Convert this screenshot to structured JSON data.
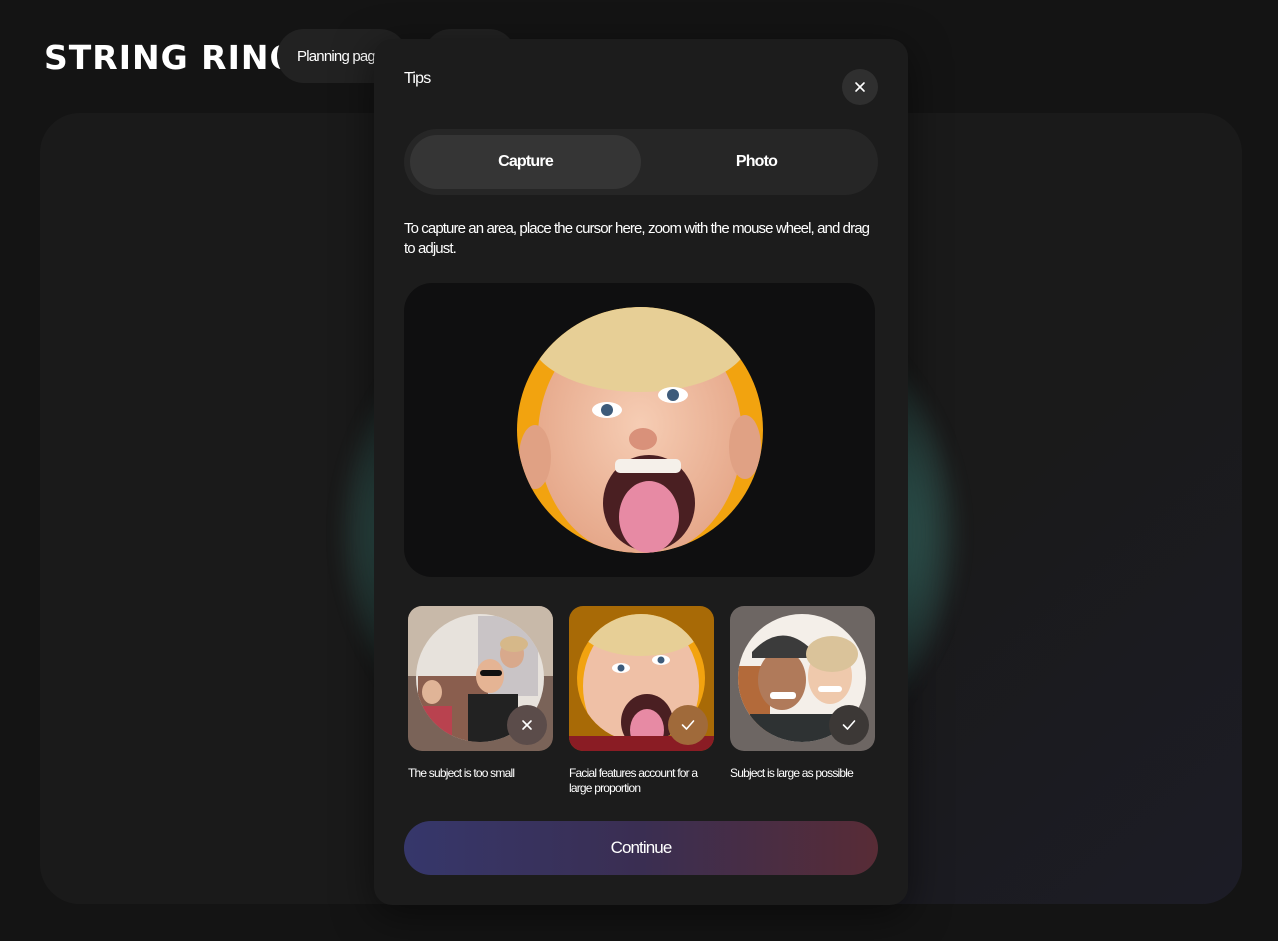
{
  "brand": {
    "logo_text": "STRING RING"
  },
  "nav": {
    "planning_label": "Planning page",
    "second_label": ""
  },
  "modal": {
    "title": "Tips",
    "tabs": [
      {
        "label": "Capture",
        "active": true
      },
      {
        "label": "Photo",
        "active": false
      }
    ],
    "description": "To capture an area, place the cursor here, zoom with the mouse wheel, and drag to adjust.",
    "examples": [
      {
        "caption": "The subject is too small",
        "status": "bad",
        "icon": "close-icon"
      },
      {
        "caption": "Facial features account for a large proportion",
        "status": "good",
        "icon": "check-icon"
      },
      {
        "caption": "Subject is large as possible",
        "status": "good",
        "icon": "check-icon"
      }
    ],
    "continue_label": "Continue"
  },
  "colors": {
    "background": "#141414",
    "modal": "#1c1c1c",
    "accent_orange": "#f2a30f",
    "glow": "#8fd9cd",
    "button_gradient_start": "#36376b",
    "button_gradient_end": "#582c36"
  }
}
